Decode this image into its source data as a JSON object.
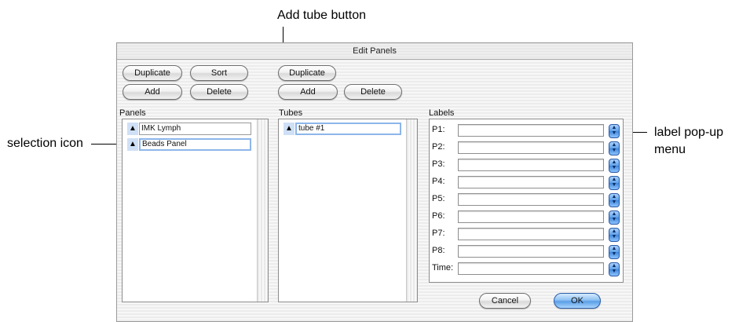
{
  "callouts": {
    "add_tube": "Add tube button",
    "selection_icon": "selection icon",
    "label_popup_line1": "label pop-up",
    "label_popup_line2": "menu"
  },
  "window": {
    "title": "Edit Panels"
  },
  "panel_buttons": {
    "duplicate": "Duplicate",
    "sort": "Sort",
    "add": "Add",
    "delete": "Delete"
  },
  "tube_buttons": {
    "duplicate": "Duplicate",
    "add": "Add",
    "delete": "Delete"
  },
  "sections": {
    "panels": "Panels",
    "tubes": "Tubes",
    "labels": "Labels"
  },
  "panels": [
    {
      "name": "IMK Lymph",
      "selected": false
    },
    {
      "name": "Beads Panel",
      "selected": true
    }
  ],
  "tubes": [
    {
      "name": "tube #1",
      "selected": true
    }
  ],
  "labels": [
    {
      "name": "P1:",
      "value": ""
    },
    {
      "name": "P2:",
      "value": ""
    },
    {
      "name": "P3:",
      "value": ""
    },
    {
      "name": "P4:",
      "value": ""
    },
    {
      "name": "P5:",
      "value": ""
    },
    {
      "name": "P6:",
      "value": ""
    },
    {
      "name": "P7:",
      "value": ""
    },
    {
      "name": "P8:",
      "value": ""
    },
    {
      "name": "Time:",
      "value": ""
    }
  ],
  "footer": {
    "cancel": "Cancel",
    "ok": "OK"
  },
  "icons": {
    "selection": "updown-arrows-icon",
    "popup": "popup-arrows-icon"
  }
}
